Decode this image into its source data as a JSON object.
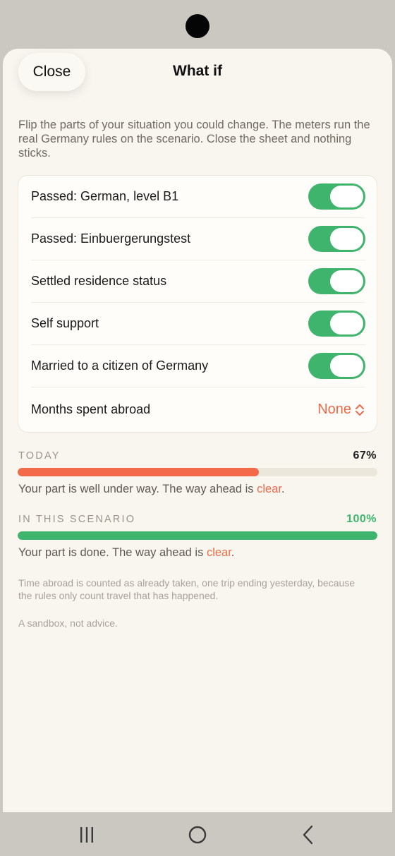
{
  "header": {
    "close_label": "Close",
    "title": "What if"
  },
  "intro": "Flip the parts of your situation you could change. The meters run the real Germany rules on the scenario. Close the sheet and nothing sticks.",
  "toggles": [
    {
      "label": "Passed: German, level B1",
      "on": true
    },
    {
      "label": "Passed: Einbuergerungstest",
      "on": true
    },
    {
      "label": "Settled residence status",
      "on": true
    },
    {
      "label": "Self support",
      "on": true
    },
    {
      "label": "Married to a citizen of Germany",
      "on": true
    }
  ],
  "months_abroad": {
    "label": "Months spent abroad",
    "value": "None"
  },
  "meters": {
    "today": {
      "label": "TODAY",
      "percent_text": "67%",
      "fraction": 0.67,
      "text_before": "Your part is well under way. The way ahead is ",
      "text_highlight": "clear",
      "text_after": ".",
      "color": "#f36a4a"
    },
    "scenario": {
      "label": "IN THIS SCENARIO",
      "percent_text": "100%",
      "fraction": 1.0,
      "text_before": "Your part is done. The way ahead is ",
      "text_highlight": "clear",
      "text_after": ".",
      "color": "#3fb46d"
    }
  },
  "footnote": "Time abroad is counted as already taken, one trip ending yesterday, because the rules only count travel that has happened.",
  "disclaimer": "A sandbox, not advice.",
  "colors": {
    "accent": "#ef6a49",
    "toggle_on": "#3fb46d"
  },
  "nav": {
    "icons": [
      "recent-apps-icon",
      "home-icon",
      "back-icon"
    ]
  }
}
